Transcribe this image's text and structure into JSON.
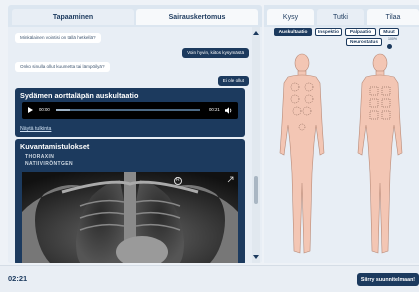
{
  "left_tabs": [
    {
      "label": "Tapaaminen",
      "active": true
    },
    {
      "label": "Sairauskertomus",
      "active": false
    }
  ],
  "chat": [
    {
      "from": "doctor",
      "text": "Minkälainen vointisi on tällä hetkellä?"
    },
    {
      "from": "patient",
      "text": "Voin hyvin, kiitos kysymästä"
    },
    {
      "from": "doctor",
      "text": "Onko sinulla ollut kuumetta tai lämpöilyä?"
    },
    {
      "from": "patient",
      "text": "Ei ole ollut"
    }
  ],
  "auscultation": {
    "title": "Sydämen aorttaläpän auskultaatio",
    "current_time": "00:00",
    "total_time": "00:21",
    "progress": 0.1,
    "link": "Näytä tulkinta"
  },
  "imaging": {
    "title": "Kuvantamistulokset",
    "sub_line1": "THORAXIN",
    "sub_line2": "NATIIVIRÖNTGEN",
    "xray_marker": "R"
  },
  "right_tabs": [
    {
      "label": "Kysy",
      "active": false
    },
    {
      "label": "Tutki",
      "active": true
    },
    {
      "label": "Tilaa",
      "active": false
    }
  ],
  "exam_chips": [
    {
      "label": "Auskultaatio",
      "active": true
    },
    {
      "label": "Inspektio",
      "active": false
    },
    {
      "label": "Palpaatio",
      "active": false
    },
    {
      "label": "Muut",
      "active": false
    },
    {
      "label": "Neurostatus",
      "active": false
    }
  ],
  "zoom_label": "100%",
  "footer": {
    "timer": "02:21",
    "next_button": "Siirry suunnitelmaan!"
  },
  "colors": {
    "navy": "#1c3a5e",
    "panel": "#e8eef5",
    "skin": "#f3c6b4"
  }
}
